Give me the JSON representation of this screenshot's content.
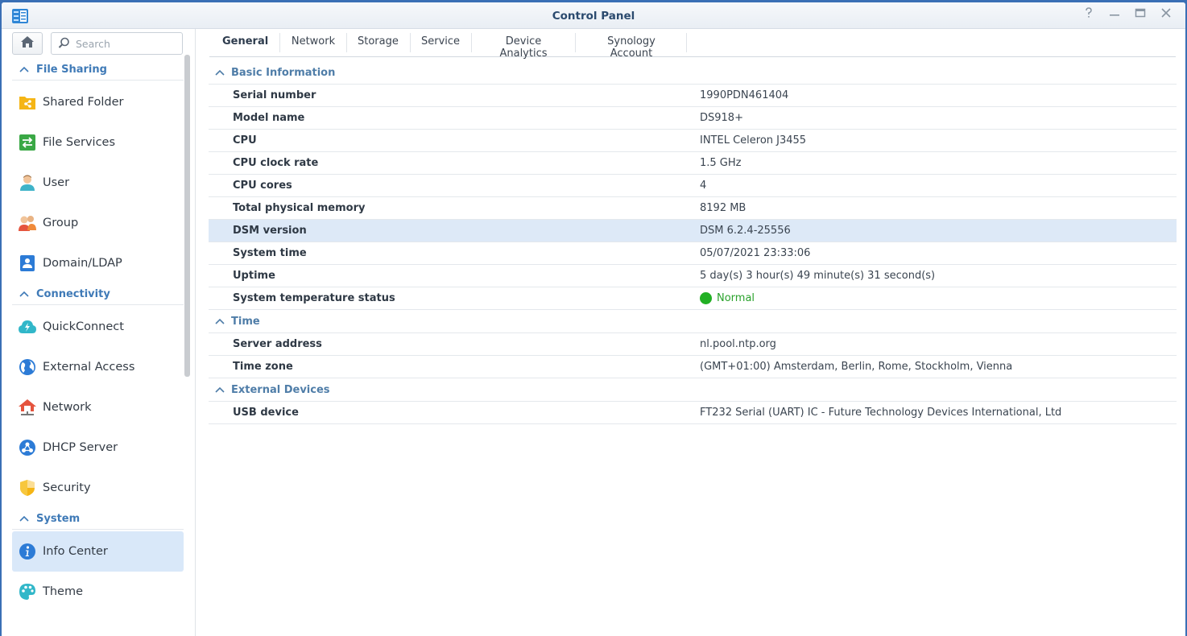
{
  "window": {
    "title": "Control Panel"
  },
  "sidebar": {
    "search_placeholder": "Search",
    "sections": [
      {
        "title": "File Sharing",
        "items": [
          "Shared Folder",
          "File Services",
          "User",
          "Group",
          "Domain/LDAP"
        ]
      },
      {
        "title": "Connectivity",
        "items": [
          "QuickConnect",
          "External Access",
          "Network",
          "DHCP Server",
          "Security"
        ]
      },
      {
        "title": "System",
        "items": [
          "Info Center",
          "Theme"
        ]
      }
    ],
    "active_item": "Info Center"
  },
  "tabs": [
    "General",
    "Network",
    "Storage",
    "Service",
    "Device Analytics",
    "Synology Account"
  ],
  "active_tab": "General",
  "groups": [
    {
      "title": "Basic Information",
      "rows": [
        {
          "key": "Serial number",
          "value": "1990PDN461404"
        },
        {
          "key": "Model name",
          "value": "DS918+"
        },
        {
          "key": "CPU",
          "value": "INTEL Celeron J3455"
        },
        {
          "key": "CPU clock rate",
          "value": "1.5 GHz"
        },
        {
          "key": "CPU cores",
          "value": "4"
        },
        {
          "key": "Total physical memory",
          "value": "8192 MB"
        },
        {
          "key": "DSM version",
          "value": "DSM 6.2.4-25556"
        },
        {
          "key": "System time",
          "value": "05/07/2021 23:33:06"
        },
        {
          "key": "Uptime",
          "value": "5 day(s) 3 hour(s) 49 minute(s) 31 second(s)"
        },
        {
          "key": "System temperature status",
          "value": "Normal"
        }
      ]
    },
    {
      "title": "Time",
      "rows": [
        {
          "key": "Server address",
          "value": "nl.pool.ntp.org"
        },
        {
          "key": "Time zone",
          "value": "(GMT+01:00) Amsterdam, Berlin, Rome, Stockholm, Vienna"
        }
      ]
    },
    {
      "title": "External Devices",
      "rows": [
        {
          "key": "USB device",
          "value": "FT232 Serial (UART) IC - Future Technology Devices International, Ltd"
        }
      ]
    }
  ],
  "colors": {
    "accent": "#3f7ab7",
    "selected_bg": "#d9e8f9",
    "status_ok": "#22b024"
  },
  "window_controls": [
    "help-icon",
    "minimize-icon",
    "maximize-icon",
    "close-icon"
  ]
}
